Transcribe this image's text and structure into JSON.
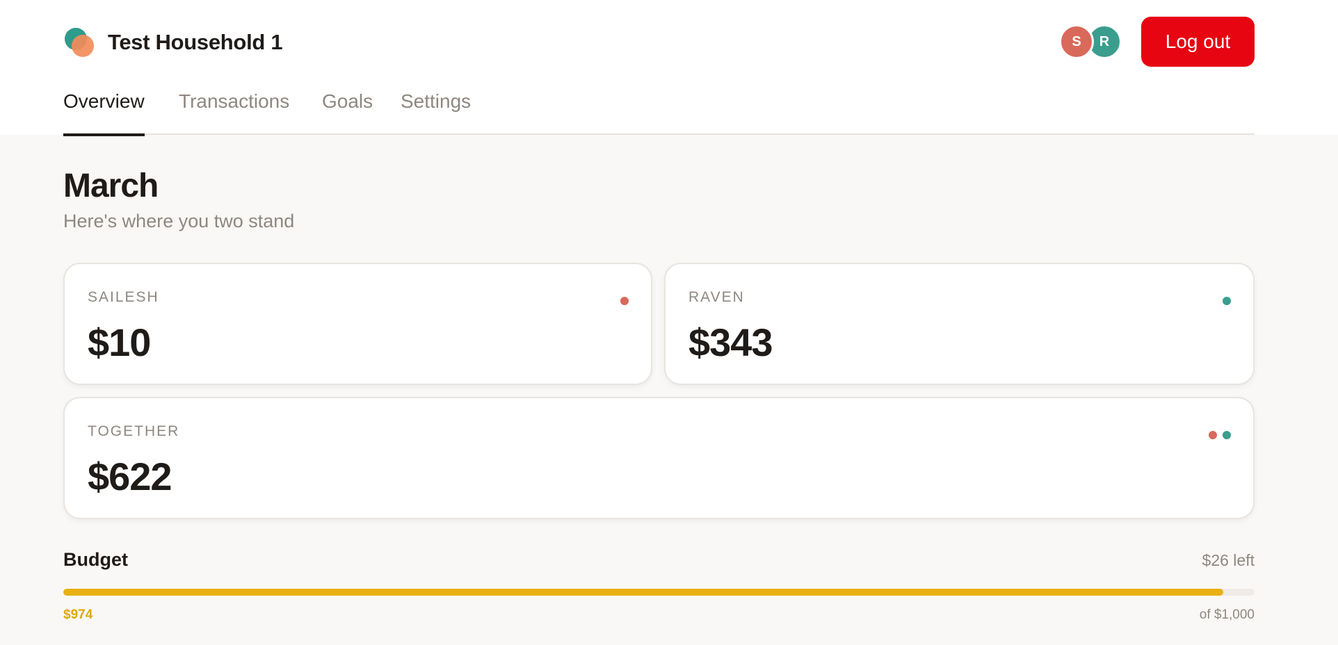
{
  "header": {
    "household_name": "Test Household 1",
    "members": [
      {
        "initial": "S",
        "color": "#d9695a"
      },
      {
        "initial": "R",
        "color": "#3a9d8e"
      }
    ],
    "logout_label": "Log out",
    "logout_color": "#e70512"
  },
  "tabs": [
    {
      "label": "Overview",
      "active": true
    },
    {
      "label": "Transactions",
      "active": false
    },
    {
      "label": "Goals",
      "active": false
    },
    {
      "label": "Settings",
      "active": false
    }
  ],
  "main": {
    "month": "March",
    "subtitle": "Here's where you two stand",
    "cards": [
      {
        "label": "SAILESH",
        "value": "$10",
        "dots": [
          "sailesh-dot-icon"
        ]
      },
      {
        "label": "RAVEN",
        "value": "$343",
        "dots": [
          "raven-dot-icon"
        ]
      },
      {
        "label": "TOGETHER",
        "value": "$622",
        "dots": [
          "sailesh-dot-icon",
          "raven-dot-icon"
        ]
      }
    ]
  },
  "budget": {
    "title": "Budget",
    "left_label": "$26 left",
    "spent": "$974",
    "total": "of $1,000",
    "progress": 0.974,
    "bar_color": "#e8b010"
  }
}
